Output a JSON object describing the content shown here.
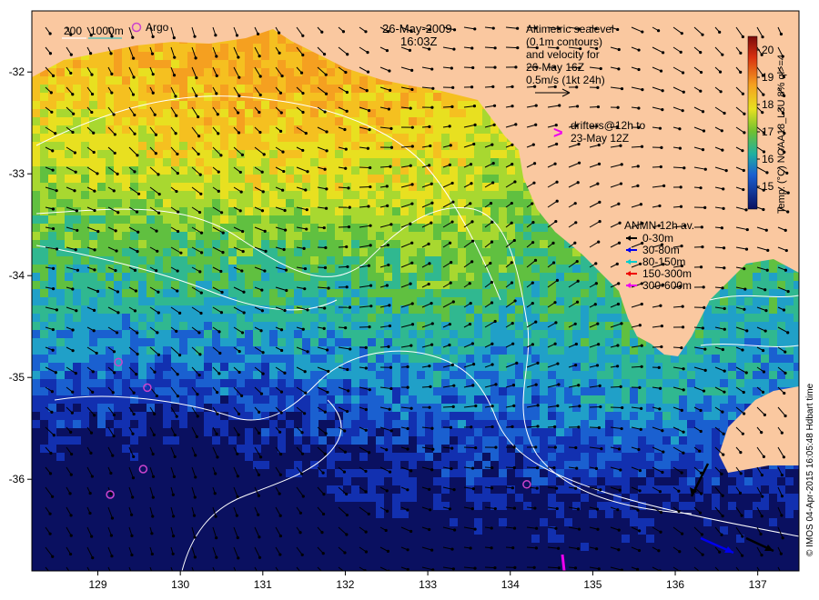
{
  "header": {
    "date": "26-May-2009",
    "time": "16:03Z"
  },
  "bathymetry_legend": {
    "label_200": "200",
    "label_1000": "1000m"
  },
  "argo_legend": {
    "label": "Argo",
    "color": "#cc44cc"
  },
  "altimetry_note": [
    "Altimetric sealevel",
    "(0.1m contours)",
    "and velocity for",
    "26-May 16Z",
    "0.5m/s (1kt 24h)"
  ],
  "drifters_note": {
    "marker": ">",
    "lines": [
      "drifters@12h to",
      "23-May 12Z"
    ],
    "color": "#ee00ee"
  },
  "anmn_legend": {
    "title": "ANMN 12h av.",
    "items": [
      {
        "label": "0-30m",
        "color": "#000000"
      },
      {
        "label": "30-80m",
        "color": "#0000ee"
      },
      {
        "label": "80-150m",
        "color": "#00cccc"
      },
      {
        "label": "150-300m",
        "color": "#ee0000"
      },
      {
        "label": "300-600m",
        "color": "#ee00ee"
      }
    ]
  },
  "colorbar": {
    "title": "Temp. (°C) NOAA18_L3U 8% ql>=4",
    "ticks": [
      "20",
      "19",
      "18",
      "17",
      "16",
      "15"
    ]
  },
  "credit": "© IMOS 04-Apr-2015 16:05:48 Hdbart time",
  "axes": {
    "x_ticks": [
      "129",
      "130",
      "131",
      "132",
      "133",
      "134",
      "135",
      "136",
      "137"
    ],
    "y_ticks": [
      "-32",
      "-33",
      "-34",
      "-35",
      "-36"
    ],
    "x_range": [
      128.2,
      137.5
    ],
    "y_range": [
      -36.9,
      -31.4
    ]
  },
  "colors": {
    "land": "#fac8a0",
    "warm": "#f5a623",
    "cold": "#0a1e90"
  }
}
